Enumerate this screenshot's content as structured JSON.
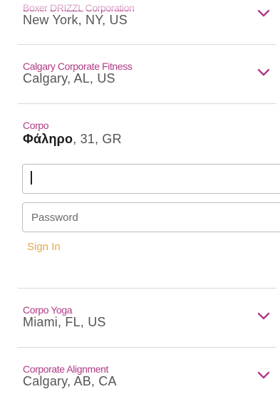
{
  "list": {
    "items": [
      {
        "name": "Boxer DRIZZL Corporation",
        "location": "New York, NY, US",
        "expanded": false
      },
      {
        "name": "Calgary Corporate Fitness",
        "location": "Calgary, AL, US",
        "expanded": false
      },
      {
        "name": "Corpo",
        "location_bold": "Φάληρο",
        "location_rest": ", 31, GR",
        "expanded": true
      },
      {
        "name": "Corpo Yoga",
        "location": "Miami, FL, US",
        "expanded": false
      },
      {
        "name": "Corporate Alignment",
        "location": "Calgary, AB, CA",
        "expanded": false
      }
    ]
  },
  "login": {
    "username_value": "",
    "password_placeholder": "Password",
    "signin_label": "Sign In"
  },
  "icons": {
    "expand": "chevron-down-icon"
  },
  "colors": {
    "name": "#b03a86",
    "location": "#555555",
    "chevron": "#b03a86",
    "signin": "#e6a64b",
    "divider": "#d9d9d9"
  }
}
